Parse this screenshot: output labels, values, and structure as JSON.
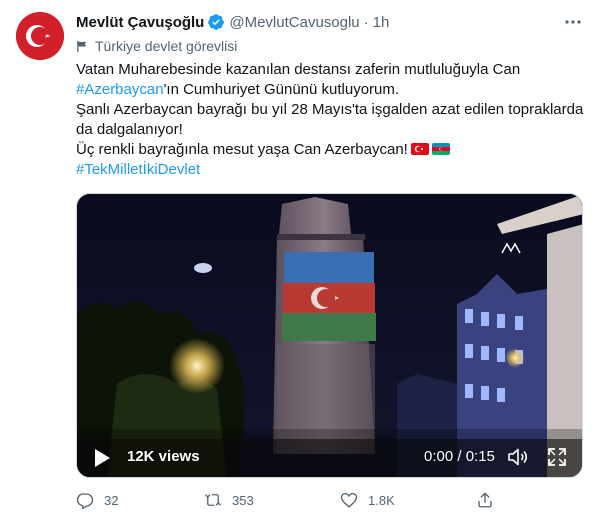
{
  "author": {
    "name": "Mevlüt Çavuşoğlu",
    "handle": "@MevlutCavusoglu",
    "separator": "·",
    "time": "1h",
    "label": "Türkiye devlet görevlisi",
    "verified_icon": "verified-badge-icon",
    "avatar_icon": "turkish-flag-avatar"
  },
  "tweet": {
    "line1": "Vatan Muharebesinde kazanılan destansı zaferin mutluluğuyla Can",
    "line2_link": "#Azerbaycan",
    "line2_rest": "'ın Cumhuriyet Gününü kutluyorum.",
    "line3": "Şanlı Azerbaycan bayrağı bu yıl 28 Mayıs'ta işgalden azat edilen topraklarda",
    "line4": "da dalgalanıyor!",
    "line5": "Üç renkli bayrağınla mesut yaşa Can Azerbaycan!",
    "hashtag": "#TekMilletİkiDevlet"
  },
  "video": {
    "views": "12K views",
    "time": "0:00 / 0:15",
    "progress": 0,
    "controls": [
      "play-icon",
      "volume-icon",
      "fullscreen-icon"
    ]
  },
  "actions": {
    "replies": "32",
    "retweets": "353",
    "likes": "1.8K",
    "icons": [
      "reply-icon",
      "retweet-icon",
      "like-icon",
      "share-icon"
    ]
  },
  "colors": {
    "accent": "#1d9bf0",
    "secondary_text": "#536471",
    "turkey_red": "#e30a17",
    "az_blue": "#0092bc",
    "az_red": "#e4002b",
    "az_green": "#00af66"
  }
}
